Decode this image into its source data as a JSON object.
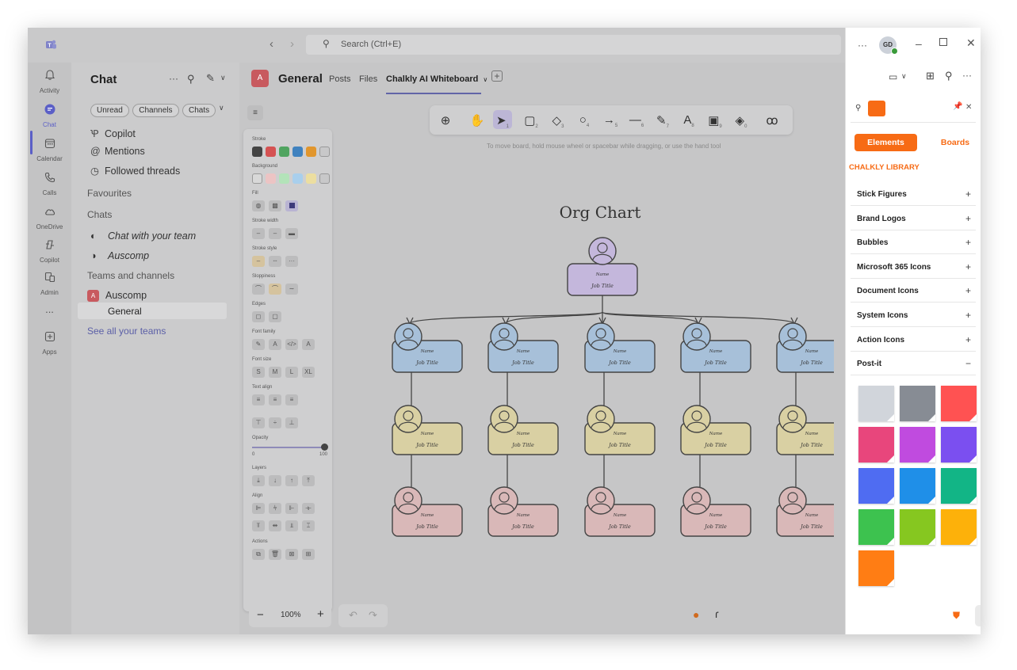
{
  "titlebar": {
    "search_placeholder": "Search (Ctrl+E)",
    "avatar_initials": "GD",
    "more": "···"
  },
  "rail": [
    {
      "label": "Activity",
      "icon": "bell-icon"
    },
    {
      "label": "Chat",
      "icon": "chat-icon"
    },
    {
      "label": "Calendar",
      "icon": "calendar-icon"
    },
    {
      "label": "Calls",
      "icon": "phone-icon"
    },
    {
      "label": "OneDrive",
      "icon": "cloud-icon"
    },
    {
      "label": "Copilot",
      "icon": "copilot-icon"
    },
    {
      "label": "Admin",
      "icon": "admin-icon"
    },
    {
      "label": "...",
      "icon": "more-icon"
    },
    {
      "label": "Apps",
      "icon": "plus-box-icon"
    }
  ],
  "chat": {
    "title": "Chat",
    "filters": [
      "Unread",
      "Channels",
      "Chats"
    ],
    "pinned": [
      "Copilot",
      "Mentions",
      "Followed threads"
    ],
    "sections": {
      "favourites": "Favourites",
      "chats": "Chats",
      "teams": "Teams and channels"
    },
    "chats": [
      "Chat with your team",
      "Auscomp"
    ],
    "team": {
      "name": "Auscomp",
      "badge": "A",
      "channel": "General"
    },
    "see_all": "See all your teams"
  },
  "channel": {
    "badge": "A",
    "name": "General",
    "tabs": [
      "Posts",
      "Files",
      "Chalkly AI Whiteboard"
    ]
  },
  "toolbar": {
    "hint": "To move board, hold mouse wheel or spacebar while dragging, or use the hand tool",
    "tool_numbers": [
      "1",
      "2",
      "3",
      "4",
      "5",
      "6",
      "7",
      "8",
      "9",
      "0"
    ]
  },
  "props": {
    "stroke": "Stroke",
    "background": "Background",
    "fill": "Fill",
    "stroke_width": "Stroke width",
    "stroke_style": "Stroke style",
    "sloppiness": "Sloppiness",
    "edges": "Edges",
    "font_family": "Font family",
    "font_size": "Font size",
    "font_sizes": [
      "S",
      "M",
      "L",
      "XL"
    ],
    "text_align": "Text align",
    "opacity": "Opacity",
    "opacity_min": "0",
    "opacity_max": "100",
    "layers": "Layers",
    "align": "Align",
    "actions": "Actions",
    "stroke_colors": [
      "#1e1e1e",
      "#e03131",
      "#2f9e44",
      "#1971c2",
      "#f08c00"
    ],
    "background_colors": [
      "#ffc9c9",
      "#b2f2bb",
      "#a5d8ff",
      "#ffec99"
    ]
  },
  "canvas": {
    "title": "Org Chart",
    "name_label": "Name",
    "job_label": "Job Title",
    "colors": {
      "top": "#c7b7e3",
      "row1": "#a5c2df",
      "row2": "#dfd5a0",
      "row3": "#dfb9b9"
    }
  },
  "zoom": {
    "level": "100%",
    "minus": "−",
    "plus": "+"
  },
  "library": {
    "tabs": [
      "Elements",
      "Boards"
    ],
    "heading": "CHALKLY LIBRARY",
    "items": [
      {
        "label": "Stick Figures",
        "sign": "+"
      },
      {
        "label": "Brand Logos",
        "sign": "+"
      },
      {
        "label": "Bubbles",
        "sign": "+"
      },
      {
        "label": "Microsoft 365 Icons",
        "sign": "+"
      },
      {
        "label": "Document Icons",
        "sign": "+"
      },
      {
        "label": "System Icons",
        "sign": "+"
      },
      {
        "label": "Action Icons",
        "sign": "+"
      },
      {
        "label": "Post-it",
        "sign": "−"
      }
    ],
    "postit_colors": [
      "#d1d5db",
      "#878c94",
      "#ff5252",
      "#e8467c",
      "#c04bdf",
      "#7b4ff0",
      "#4f6cf2",
      "#1f8fe8",
      "#12b586",
      "#3dc24f",
      "#86c720",
      "#fdb10a",
      "#ff7d14"
    ],
    "accent": "#f76b15"
  }
}
